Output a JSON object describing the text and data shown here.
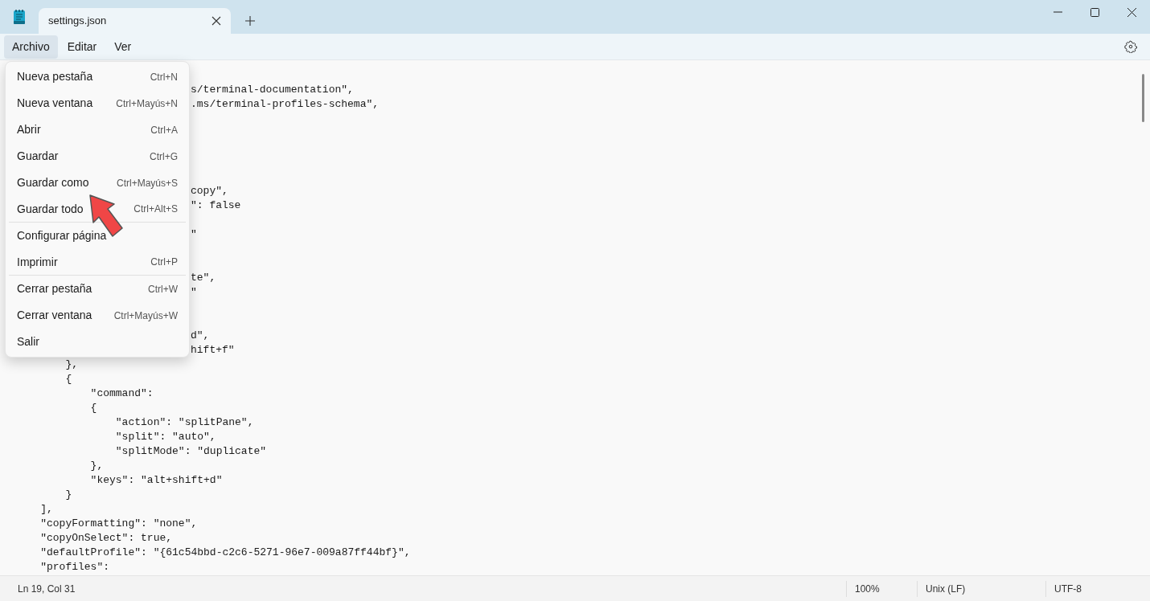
{
  "tab": {
    "title": "settings.json"
  },
  "menubar": [
    {
      "label": "Archivo",
      "selected": true
    },
    {
      "label": "Editar",
      "selected": false
    },
    {
      "label": "Ver",
      "selected": false
    }
  ],
  "file_menu": [
    {
      "label": "Nueva pestaña",
      "shortcut": "Ctrl+N",
      "separator_after": false
    },
    {
      "label": "Nueva ventana",
      "shortcut": "Ctrl+Mayús+N",
      "separator_after": false
    },
    {
      "label": "Abrir",
      "shortcut": "Ctrl+A",
      "separator_after": false
    },
    {
      "label": "Guardar",
      "shortcut": "Ctrl+G",
      "separator_after": false
    },
    {
      "label": "Guardar como",
      "shortcut": "Ctrl+Mayús+S",
      "separator_after": false
    },
    {
      "label": "Guardar todo",
      "shortcut": "Ctrl+Alt+S",
      "separator_after": true
    },
    {
      "label": "Configurar página",
      "separator_after": false
    },
    {
      "label": "Imprimir",
      "shortcut": "Ctrl+P",
      "separator_after": true
    },
    {
      "label": "Cerrar pestaña",
      "shortcut": "Ctrl+W",
      "separator_after": false
    },
    {
      "label": "Cerrar ventana",
      "shortcut": "Ctrl+Mayús+W",
      "separator_after": false
    },
    {
      "label": "Salir",
      "separator_after": false
    }
  ],
  "editor": {
    "lines": [
      {
        "kind": "covered"
      },
      {
        "kind": "fragment",
        "text": "s/terminal-documentation\","
      },
      {
        "kind": "fragment",
        "text": ".ms/terminal-profiles-schema\","
      },
      {
        "kind": "covered"
      },
      {
        "kind": "covered"
      },
      {
        "kind": "covered"
      },
      {
        "kind": "covered"
      },
      {
        "kind": "covered"
      },
      {
        "kind": "fragment",
        "text": "copy\","
      },
      {
        "kind": "fragment",
        "text": "\": false"
      },
      {
        "kind": "covered"
      },
      {
        "kind": "fragment",
        "text": "\""
      },
      {
        "kind": "covered"
      },
      {
        "kind": "covered"
      },
      {
        "kind": "fragment",
        "text": "te\","
      },
      {
        "kind": "fragment",
        "text": "\""
      },
      {
        "kind": "covered"
      },
      {
        "kind": "covered"
      },
      {
        "kind": "fragment",
        "text": "d\","
      },
      {
        "kind": "fragment",
        "text": "hift+f\""
      },
      {
        "kind": "code",
        "text": "        },"
      },
      {
        "kind": "code",
        "text": "        {"
      },
      {
        "kind": "code",
        "text": "            \"command\":"
      },
      {
        "kind": "code",
        "text": "            {"
      },
      {
        "kind": "code",
        "text": "                \"action\": \"splitPane\","
      },
      {
        "kind": "code",
        "text": "                \"split\": \"auto\","
      },
      {
        "kind": "code",
        "text": "                \"splitMode\": \"duplicate\""
      },
      {
        "kind": "code",
        "text": "            },"
      },
      {
        "kind": "code",
        "text": "            \"keys\": \"alt+shift+d\""
      },
      {
        "kind": "code",
        "text": "        }"
      },
      {
        "kind": "code",
        "text": "    ],"
      },
      {
        "kind": "code",
        "text": "    \"copyFormatting\": \"none\","
      },
      {
        "kind": "code",
        "text": "    \"copyOnSelect\": true,"
      },
      {
        "kind": "code",
        "text": "    \"defaultProfile\": \"{61c54bbd-c2c6-5271-96e7-009a87ff44bf}\","
      },
      {
        "kind": "code",
        "text": "    \"profiles\":"
      }
    ]
  },
  "status_bar": {
    "position": "Ln 19, Col 31",
    "zoom": "100%",
    "line_ending": "Unix (LF)",
    "encoding": "UTF-8"
  }
}
